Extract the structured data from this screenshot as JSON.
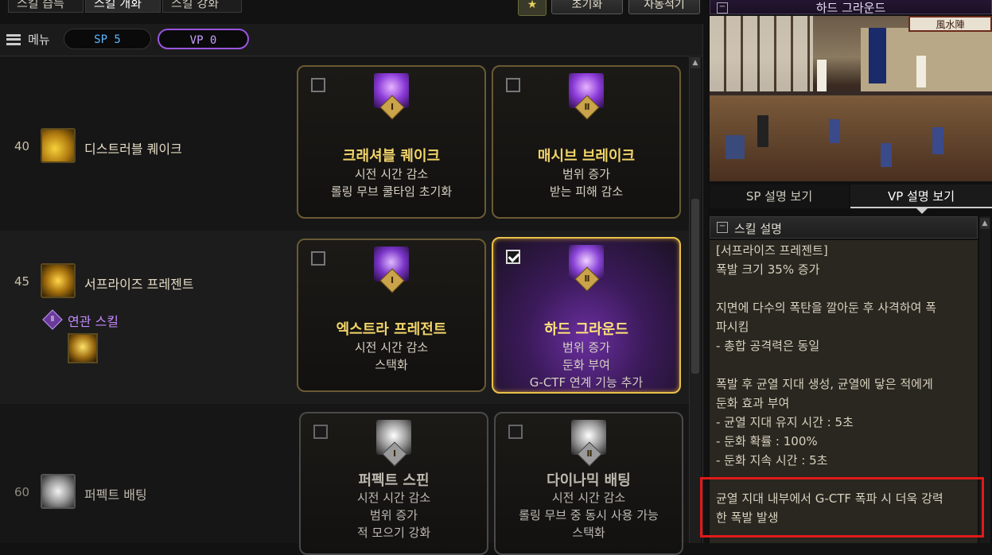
{
  "top_tabs": [
    "스킬 습득",
    "스킬 개화",
    "스킬 강화"
  ],
  "top_buttons": {
    "reset": "초기화",
    "auto": "자동적기"
  },
  "menu": {
    "label": "메뉴",
    "sp": "SP 5",
    "vp": "VP 0"
  },
  "rows": [
    {
      "level": "40",
      "skill_name": "디스트러블 퀘이크",
      "cards": [
        {
          "rank": "Ⅰ",
          "title": "크래셔블 퀘이크",
          "lines": [
            "시전 시간 감소",
            "롤링 무브 쿨타임 초기화"
          ],
          "checked": false
        },
        {
          "rank": "Ⅱ",
          "title": "매시브 브레이크",
          "lines": [
            "범위 증가",
            "받는 피해 감소"
          ],
          "checked": false
        }
      ]
    },
    {
      "level": "45",
      "skill_name": "서프라이즈 프레젠트",
      "related_label": "연관 스킬",
      "related_rank": "Ⅱ",
      "cards": [
        {
          "rank": "Ⅰ",
          "title": "엑스트라 프레전트",
          "lines": [
            "시전 시간 감소",
            "스택화"
          ],
          "checked": false
        },
        {
          "rank": "Ⅱ",
          "title": "하드 그라운드",
          "lines": [
            "범위 증가",
            "둔화 부여",
            "G-CTF 연계 기능 추가"
          ],
          "checked": true
        }
      ]
    },
    {
      "level": "60",
      "skill_name": "퍼펙트 배팅",
      "cards": [
        {
          "rank": "Ⅰ",
          "title": "퍼펙트 스핀",
          "lines": [
            "시전 시간 감소",
            "범위 증가",
            "적 모으기 강화"
          ],
          "checked": false
        },
        {
          "rank": "Ⅱ",
          "title": "다이나믹 배팅",
          "lines": [
            "시전 시간 감소",
            "롤링 무브 중 동시 사용 가능",
            "스택화"
          ],
          "checked": false
        }
      ]
    }
  ],
  "right": {
    "title": "하드 그라운드",
    "banner_text": "風水陣",
    "tab_sp": "SP 설명 보기",
    "tab_vp": "VP 설명 보기",
    "section_title": "스킬 설명",
    "desc": [
      "[서프라이즈 프레젠트]",
      "폭발 크기 35% 증가",
      "",
      "지면에 다수의 폭탄을 깔아둔 후 사격하여 폭",
      "파시킴",
      "- 총합 공격력은 동일",
      "",
      "폭발 후 균열 지대 생성, 균열에 닿은 적에게",
      "둔화 효과 부여",
      "- 균열 지대 유지 시간 : 5초",
      "- 둔화 확률 : 100%",
      "- 둔화 지속 시간 : 5초",
      "",
      "균열 지대 내부에서 G-CTF 폭파 시 더욱 강력",
      "한 폭발 발생"
    ]
  },
  "colors": {
    "gold": "#f1d46a",
    "purple": "#8a4fd0",
    "highlight_box": "#e01a1a"
  }
}
